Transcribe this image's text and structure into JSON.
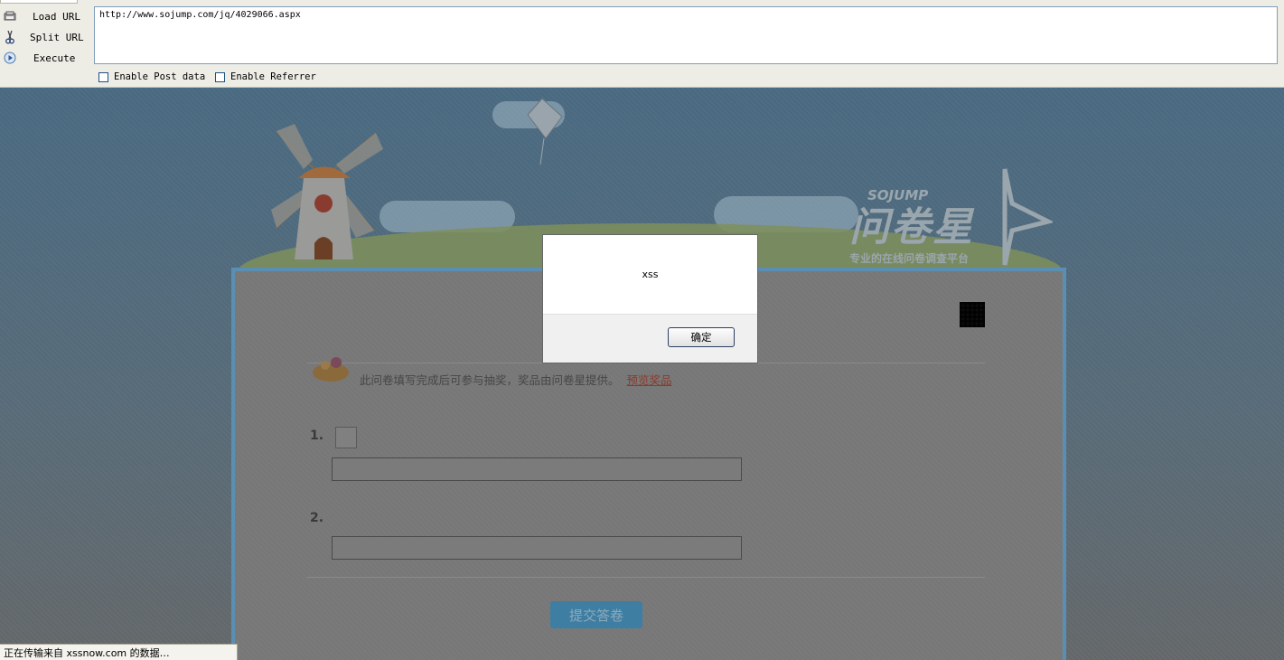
{
  "hackbar": {
    "load_url": "Load URL",
    "split_url": "Split URL",
    "execute": "Execute",
    "url_value": "http://www.sojump.com/jq/4029066.aspx",
    "enable_post": "Enable Post data",
    "enable_referrer": "Enable Referrer"
  },
  "site": {
    "logo_cn": "问卷星",
    "logo_en": "SOJUMP",
    "logo_sub": "专业的在线问卷调查平台",
    "notice": "此问卷填写完成后可参与抽奖，奖品由问卷星提供。",
    "notice_link": "预览奖品",
    "q1_number": "1.",
    "q2_number": "2.",
    "submit_label": "提交答卷"
  },
  "alert": {
    "message": "xss",
    "ok_label": "确定"
  },
  "status_bar": {
    "text": "正在传输来自 xssnow.com 的数据…"
  }
}
